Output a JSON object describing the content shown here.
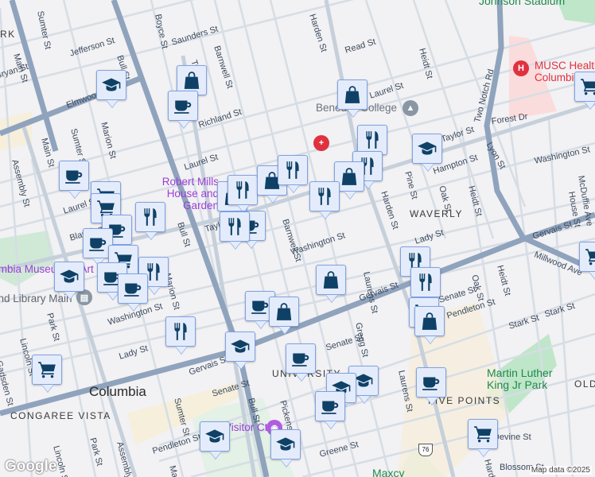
{
  "map": {
    "neighborhoods": [
      "WAVERLY",
      "UNIVERSITY",
      "FIVE POINTS",
      "CONGAREE VISTA",
      "OLD"
    ],
    "city": "Columbia",
    "pois": {
      "robert_mills": "Robert Mills House and Garden",
      "museum": "Columbia Museum of Art",
      "library": "Richland Library Main",
      "benedict": "Benedict College",
      "musc": "MUSC Health Columbia",
      "stadium": "Johnson Stadium",
      "mlk_park": "Martin Luther King Jr Park",
      "maxcy": "Maxcy",
      "visitor": "Visitor Ctr",
      "park_k": "RK"
    },
    "streets": {
      "main1": "Main St",
      "sumter1": "Sumter St",
      "jefferson": "Jefferson St",
      "bryan": "Bryan St",
      "bull1": "Bull St",
      "boyce": "Boyce St",
      "saunders": "Saunders St",
      "talley": "Talley St",
      "barnwell1": "Barnwell St",
      "elmwood": "Elmwood Ave",
      "marion1": "Marion St",
      "main2": "Main St",
      "sumter2": "Sumter St",
      "assembly1": "Assembly St",
      "richland": "Richland St",
      "laurel1": "Laurel St",
      "laurel2": "Laurel St",
      "bull2": "Bull St",
      "taylor1": "Taylor St",
      "barnwell2": "Barnwell St",
      "harden1": "Harden St",
      "read": "Read St",
      "heidt1": "Heidt St",
      "laurel3": "Laurel St",
      "two_notch": "Two Notch Rd",
      "forest": "Forest Dr",
      "taylor2": "Taylor St",
      "lyon": "Lyon St",
      "washington1": "Washington St",
      "pine": "Pine St",
      "hampton": "Hampton St",
      "oak1": "Oak St",
      "heidt2": "Heidt St",
      "house": "House St",
      "mcduffie": "McDuffie Ave",
      "harden2": "Harden St",
      "gervais1": "Gervais St",
      "lady1": "Lady St",
      "washington2": "Washington St",
      "marion2": "Marion St",
      "park1": "Park St",
      "lincoln1": "Lincoln St",
      "gadsden": "Gadsden St",
      "washington3": "Washington St",
      "lady2": "Lady St",
      "gervais2": "Gervais St",
      "sumter3": "Sumter St",
      "senate1": "Senate St",
      "bull3": "Bull St",
      "pickens": "Pickens St",
      "lincoln2": "Lincoln St",
      "park2": "Park St",
      "assembly2": "Assembly St",
      "pendleton1": "Pendleton St",
      "main3": "Main St",
      "laurens1": "Laurens St",
      "gregg": "Gregg St",
      "senate2": "Senate St",
      "senate3": "Senate St",
      "pendleton2": "Pendleton St",
      "oak2": "Oak St",
      "heidt3": "Heidt St",
      "stark1": "Stark St",
      "stark2": "Stark St",
      "millwood": "Millwood Ave",
      "gervais3": "Gervais St",
      "laurens2": "Laurens St",
      "greene": "Greene St",
      "devine": "Devine St",
      "blossom": "Blossom St",
      "harden3": "Harden St",
      "blanding": "Blanding St"
    },
    "route_shield": "76",
    "markers": [
      "school",
      "bag",
      "coffee",
      "coffee",
      "cart",
      "cart",
      "fork",
      "coffee",
      "coffee",
      "cart",
      "school",
      "coffee",
      "fork",
      "coffee",
      "fork",
      "school",
      "cart",
      "bag",
      "fork",
      "coffee",
      "fork",
      "bag",
      "fork",
      "bag",
      "fork",
      "fork",
      "bag",
      "fork",
      "school",
      "cart",
      "bag",
      "coffee",
      "bag",
      "fork",
      "fork",
      "cart",
      "bag",
      "coffee",
      "school",
      "school",
      "coffee",
      "coffee",
      "cart",
      "school",
      "school",
      "cart"
    ],
    "attribution": "Map data ©2025",
    "logo": "Google"
  }
}
